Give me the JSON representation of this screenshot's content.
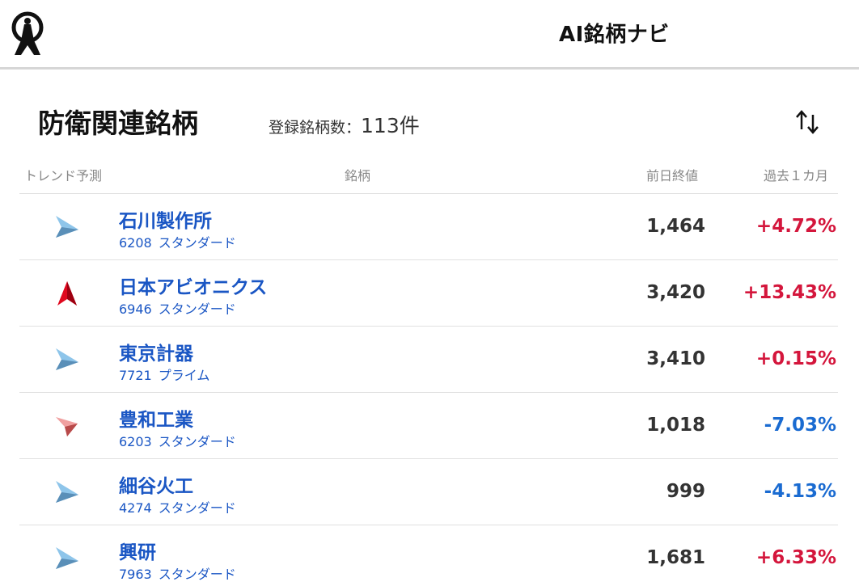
{
  "header": {
    "app_title": "AI銘柄ナビ",
    "logo_icon": "lighthouse-logo-icon"
  },
  "page": {
    "title": "防衛関連銘柄",
    "count_label": "登録銘柄数：",
    "count_value": "113件",
    "sort_icon": "sort-arrows-icon"
  },
  "columns": {
    "trend": "トレンド予測",
    "name": "銘柄",
    "close": "前日終値",
    "month": "過去１カ月"
  },
  "colors": {
    "up": "#d4163c",
    "down": "#1a6bd1",
    "link": "#1a56c4",
    "trend_up_strong": "#d0021b",
    "trend_flat_up": "#7fb8e0",
    "trend_down": "#e48a8a"
  },
  "stocks": [
    {
      "name": "石川製作所",
      "code": "6208",
      "market": "スタンダード",
      "close": "1,464",
      "change": "+4.72%",
      "dir": "up",
      "trend": "up-slight"
    },
    {
      "name": "日本アビオニクス",
      "code": "6946",
      "market": "スタンダード",
      "close": "3,420",
      "change": "+13.43%",
      "dir": "up",
      "trend": "up-strong"
    },
    {
      "name": "東京計器",
      "code": "7721",
      "market": "プライム",
      "close": "3,410",
      "change": "+0.15%",
      "dir": "up",
      "trend": "up-slight"
    },
    {
      "name": "豊和工業",
      "code": "6203",
      "market": "スタンダード",
      "close": "1,018",
      "change": "-7.03%",
      "dir": "down",
      "trend": "down"
    },
    {
      "name": "細谷火工",
      "code": "4274",
      "market": "スタンダード",
      "close": "999",
      "change": "-4.13%",
      "dir": "down",
      "trend": "up-slight"
    },
    {
      "name": "興研",
      "code": "7963",
      "market": "スタンダード",
      "close": "1,681",
      "change": "+6.33%",
      "dir": "up",
      "trend": "up-slight"
    }
  ]
}
